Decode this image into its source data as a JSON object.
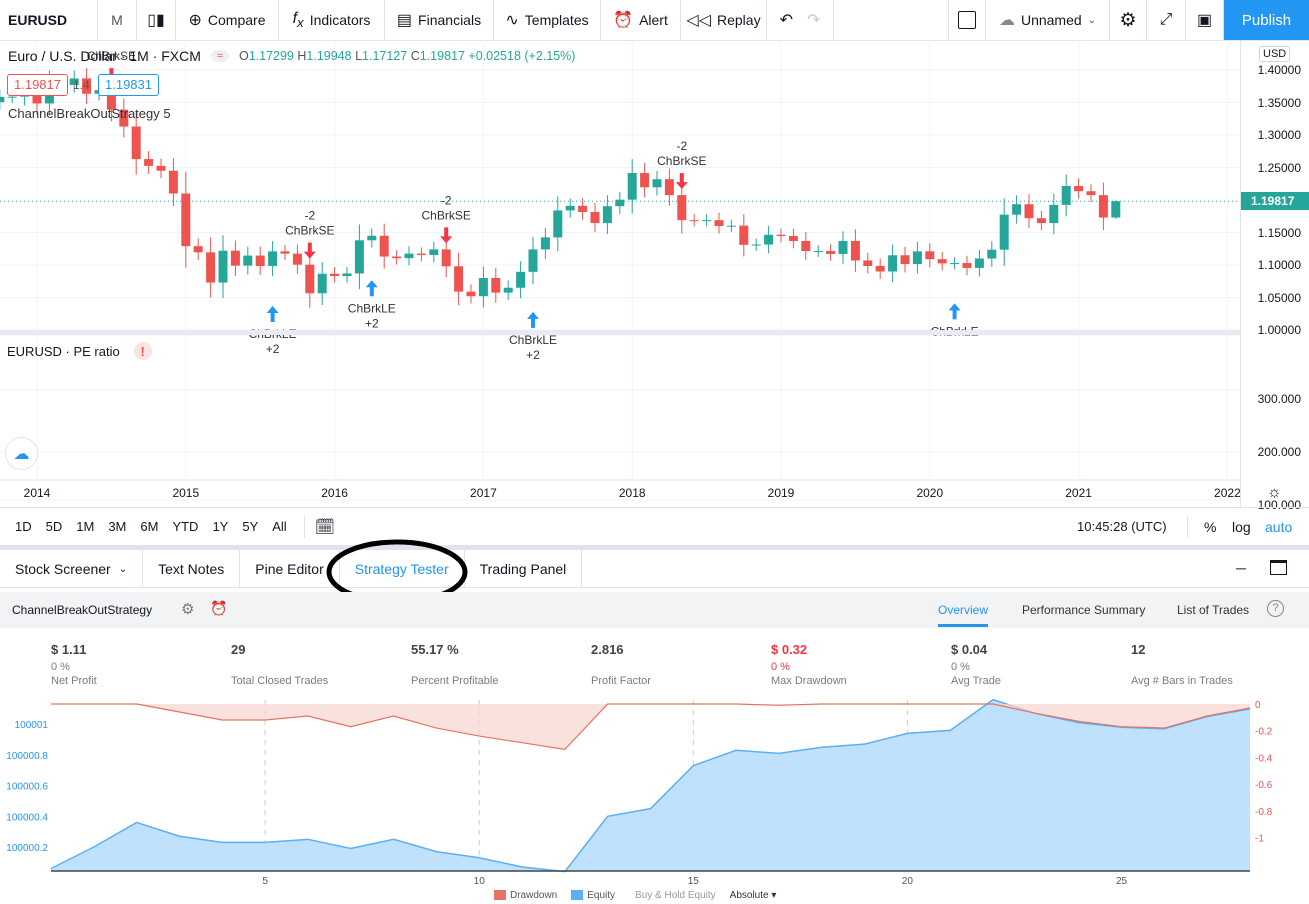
{
  "toolbar": {
    "symbol": "EURUSD",
    "interval": "M",
    "compare": "Compare",
    "indicators": "Indicators",
    "financials": "Financials",
    "templates": "Templates",
    "alert": "Alert",
    "replay": "Replay",
    "layout_name": "Unnamed",
    "publish": "Publish"
  },
  "legend": {
    "title": "Euro / U.S. Dollar · 1M · FXCM",
    "o": "1.17299",
    "h": "1.19948",
    "l": "1.17127",
    "c": "1.19817",
    "change": "+0.02518 (+2.15%)",
    "bid": "1.19817",
    "ask": "1.19831",
    "ask_mid": "1.4",
    "strategy": "ChannelBreakOutStrategy 5"
  },
  "price_axis": {
    "currency": "USD",
    "ticks": [
      "1.40000",
      "1.35000",
      "1.30000",
      "1.25000",
      "1.15000",
      "1.10000",
      "1.05000",
      "1.00000"
    ],
    "last_price": "1.19817"
  },
  "pe_pane": {
    "title": "EURUSD · PE ratio",
    "ticks": [
      "300.000",
      "200.000",
      "100.000"
    ]
  },
  "time_axis": [
    "2014",
    "2015",
    "2016",
    "2017",
    "2018",
    "2019",
    "2020",
    "2021",
    "2022"
  ],
  "colors": {
    "up": "#26a69a",
    "down": "#ef5350",
    "accent": "#2196f3",
    "equity": "#5ab0f5",
    "drawdown": "#e57363"
  },
  "candles": {
    "start": "2013-10",
    "first_open": 1.3505,
    "closes": [
      1.3585,
      1.359,
      1.3745,
      1.3485,
      1.3805,
      1.377,
      1.387,
      1.3635,
      1.369,
      1.339,
      1.313,
      1.263,
      1.2525,
      1.245,
      1.21,
      1.129,
      1.1195,
      1.073,
      1.122,
      1.099,
      1.1145,
      1.0985,
      1.121,
      1.1175,
      1.1005,
      1.0565,
      1.0865,
      1.083,
      1.087,
      1.138,
      1.145,
      1.113,
      1.1105,
      1.1175,
      1.1155,
      1.124,
      1.098,
      1.059,
      1.052,
      1.08,
      1.0575,
      1.065,
      1.0895,
      1.124,
      1.1425,
      1.184,
      1.191,
      1.1815,
      1.1645,
      1.1905,
      1.2005,
      1.2415,
      1.2195,
      1.232,
      1.2075,
      1.169,
      1.1685,
      1.169,
      1.16,
      1.1605,
      1.131,
      1.1315,
      1.1465,
      1.1445,
      1.137,
      1.1215,
      1.1215,
      1.117,
      1.137,
      1.107,
      1.0985,
      1.09,
      1.115,
      1.1015,
      1.121,
      1.109,
      1.1025,
      1.103,
      1.0955,
      1.11,
      1.1235,
      1.1775,
      1.1935,
      1.172,
      1.1645,
      1.1925,
      1.2215,
      1.2135,
      1.2075,
      1.173
    ],
    "last": {
      "o": 1.17299,
      "h": 1.19948,
      "l": 1.17127,
      "c": 1.19817
    }
  },
  "signals": [
    {
      "date": "2014-07",
      "side": "short",
      "label": "ChBrkSE",
      "qty": ""
    },
    {
      "date": "2015-08",
      "side": "long",
      "label": "ChBrkLE",
      "qty": "+2"
    },
    {
      "date": "2015-11",
      "side": "short",
      "label": "ChBrkSE",
      "qty": "-2"
    },
    {
      "date": "2016-04",
      "side": "long",
      "label": "ChBrkLE",
      "qty": "+2"
    },
    {
      "date": "2016-10",
      "side": "short",
      "label": "ChBrkSE",
      "qty": "-2"
    },
    {
      "date": "2017-05",
      "side": "long",
      "label": "ChBrkLE",
      "qty": "+2"
    },
    {
      "date": "2018-05",
      "side": "short",
      "label": "ChBrkSE",
      "qty": "-2"
    },
    {
      "date": "2020-03",
      "side": "long",
      "label": "ChBrkLE",
      "qty": ""
    }
  ],
  "range_bar": {
    "ranges": [
      "1D",
      "5D",
      "1M",
      "3M",
      "6M",
      "YTD",
      "1Y",
      "5Y",
      "All"
    ],
    "clock": "10:45:28 (UTC)",
    "pct": "%",
    "log": "log",
    "auto": "auto"
  },
  "bottom_tabs": [
    "Stock Screener",
    "Text Notes",
    "Pine Editor",
    "Strategy Tester",
    "Trading Panel"
  ],
  "active_tab": "Strategy Tester",
  "strategy": {
    "name": "ChannelBreakOutStrategy",
    "tabs": [
      "Overview",
      "Performance Summary",
      "List of Trades"
    ],
    "active": "Overview"
  },
  "stats": [
    {
      "value": "$ 1.11",
      "pct": "0 %",
      "label": "Net Profit"
    },
    {
      "value": "29",
      "pct": "",
      "label": "Total Closed Trades"
    },
    {
      "value": "55.17 %",
      "pct": "",
      "label": "Percent Profitable"
    },
    {
      "value": "2.816",
      "pct": "",
      "label": "Profit Factor"
    },
    {
      "value": "$ 0.32",
      "pct": "0 %",
      "label": "Max Drawdown",
      "negative": true
    },
    {
      "value": "$ 0.04",
      "pct": "0 %",
      "label": "Avg Trade"
    },
    {
      "value": "12",
      "pct": "",
      "label": "Avg # Bars in Trades"
    }
  ],
  "chart_data": {
    "type": "area",
    "x": [
      0,
      1,
      2,
      3,
      4,
      5,
      6,
      7,
      8,
      9,
      10,
      11,
      12,
      13,
      14,
      15,
      16,
      17,
      18,
      19,
      20,
      21,
      22,
      23,
      24,
      25,
      26,
      27,
      28
    ],
    "x_ticks": [
      "5",
      "10",
      "15",
      "20",
      "25"
    ],
    "series": [
      {
        "name": "Equity",
        "axis": "left",
        "values": [
          100000.06,
          100000.2,
          100000.36,
          100000.27,
          100000.23,
          100000.23,
          100000.25,
          100000.19,
          100000.25,
          100000.17,
          100000.13,
          100000.07,
          100000.04,
          100000.4,
          100000.45,
          100000.73,
          100000.83,
          100000.81,
          100000.85,
          100000.87,
          100000.94,
          100000.96,
          100001.16,
          100001.07,
          100001.01,
          100000.98,
          100000.97,
          100001.05,
          100001.1
        ]
      },
      {
        "name": "Drawdown",
        "axis": "right",
        "values": [
          0,
          0,
          0,
          -0.06,
          -0.12,
          -0.12,
          -0.09,
          -0.17,
          -0.09,
          -0.18,
          -0.24,
          -0.29,
          -0.34,
          0,
          0,
          0,
          0,
          -0.01,
          0,
          0,
          0,
          0,
          0,
          -0.07,
          -0.13,
          -0.17,
          -0.18,
          -0.09,
          -0.03
        ]
      }
    ],
    "left_ticks": [
      "100001",
      "100000.8",
      "100000.6",
      "100000.4",
      "100000.2"
    ],
    "right_ticks": [
      "0",
      "-0.2",
      "-0.4",
      "-0.6",
      "-0.8",
      "-1"
    ],
    "legend": [
      "Drawdown",
      "Equity",
      "Buy & Hold Equity"
    ],
    "mode": "Absolute"
  }
}
